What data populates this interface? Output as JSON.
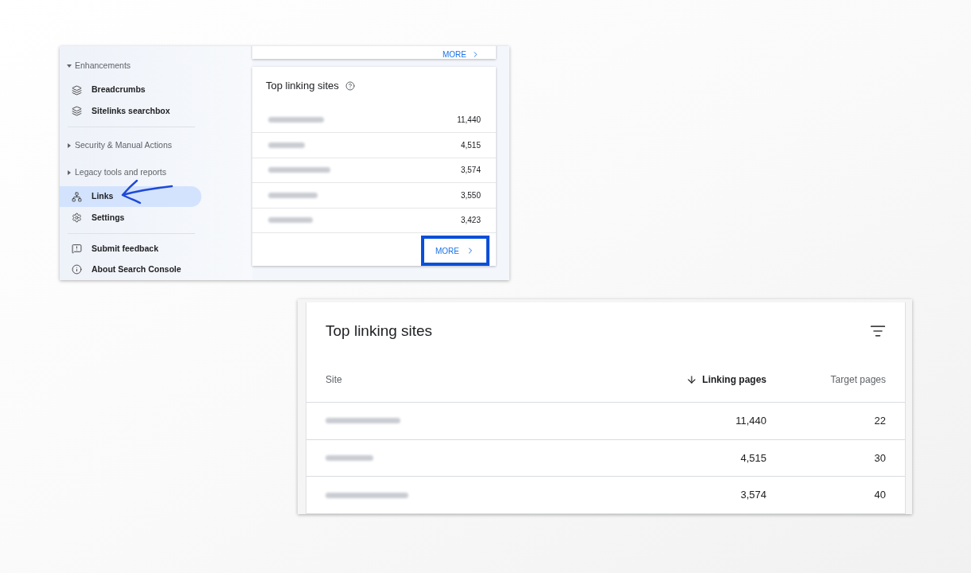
{
  "sidebar": {
    "items": [
      {
        "kind": "section",
        "label": "Enhancements",
        "expanded": true
      },
      {
        "kind": "item",
        "label": "Breadcrumbs",
        "selected": false
      },
      {
        "kind": "item",
        "label": "Sitelinks searchbox",
        "selected": false
      },
      {
        "kind": "divider"
      },
      {
        "kind": "section",
        "label": "Security & Manual Actions",
        "expanded": false
      },
      {
        "kind": "section",
        "label": "Legacy tools and reports",
        "expanded": false
      },
      {
        "kind": "item",
        "label": "Links",
        "selected": true
      },
      {
        "kind": "item",
        "label": "Settings",
        "selected": false
      },
      {
        "kind": "divider"
      },
      {
        "kind": "item",
        "label": "Submit feedback",
        "selected": false
      },
      {
        "kind": "item",
        "label": "About Search Console",
        "selected": false
      }
    ]
  },
  "upper_card": {
    "more": "MORE"
  },
  "linking_card": {
    "title": "Top linking sites",
    "rows": [
      {
        "value": "11,440"
      },
      {
        "value": "4,515"
      },
      {
        "value": "3,574"
      },
      {
        "value": "3,550"
      },
      {
        "value": "3,423"
      }
    ],
    "more": {
      "label": "MORE",
      "highlighted": true
    }
  },
  "table": {
    "title": "Top linking sites",
    "columns": [
      {
        "label": "Site",
        "sorted": false
      },
      {
        "label": "Linking pages",
        "sorted": true
      },
      {
        "label": "Target pages",
        "sorted": false
      }
    ],
    "rows": [
      {
        "linking_pages": "11,440",
        "target_pages": "22"
      },
      {
        "linking_pages": "4,515",
        "target_pages": "30"
      },
      {
        "linking_pages": "3,574",
        "target_pages": "40"
      }
    ]
  }
}
